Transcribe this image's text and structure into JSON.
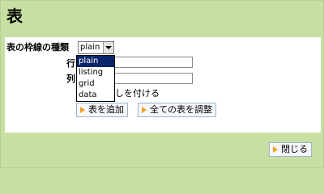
{
  "title": "表",
  "form": {
    "border_type_label": "表の枠線の種類",
    "border_type_value": "plain",
    "rows_label": "行",
    "cols_label": "列",
    "caption_text": "しを付ける",
    "rows_value": "",
    "cols_value": ""
  },
  "dropdown": {
    "options": [
      "plain",
      "listing",
      "grid",
      "data"
    ],
    "selected_index": 0
  },
  "buttons": {
    "add_table": "表を追加",
    "adjust_all": "全ての表を調整",
    "close": "閉じる"
  },
  "colors": {
    "background": "#c8dfa4",
    "selected_option": "#0a246a",
    "button_icon": "#f0a020"
  }
}
